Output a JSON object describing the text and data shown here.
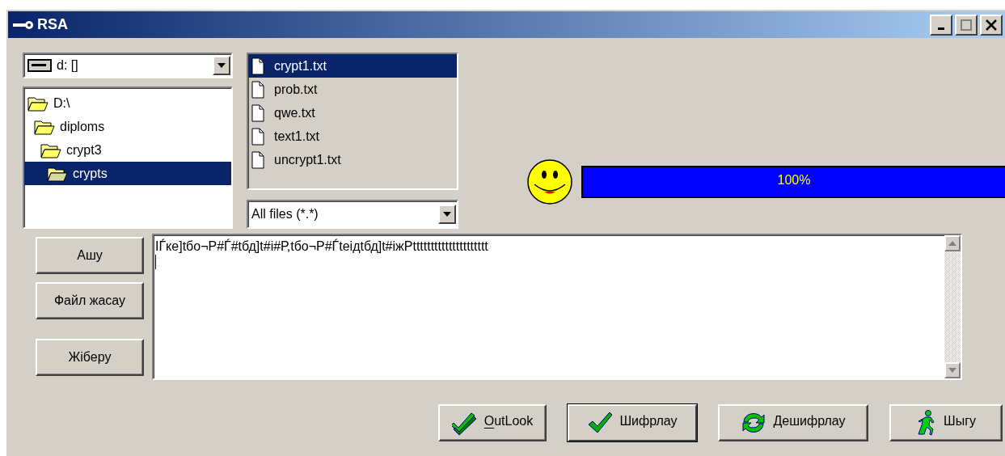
{
  "window": {
    "title": "RSA"
  },
  "drive_selector": {
    "value": "d: []"
  },
  "folder_tree": [
    {
      "label": "D:\\",
      "selected": false,
      "children": [
        {
          "label": "diploms",
          "selected": false,
          "children": [
            {
              "label": "crypt3",
              "selected": false,
              "children": [
                {
                  "label": "crypts",
                  "selected": true
                }
              ]
            }
          ]
        }
      ]
    }
  ],
  "file_list": [
    {
      "name": "crypt1.txt",
      "selected": true
    },
    {
      "name": "prob.txt",
      "selected": false
    },
    {
      "name": "qwe.txt",
      "selected": false
    },
    {
      "name": "text1.txt",
      "selected": false
    },
    {
      "name": "uncrypt1.txt",
      "selected": false
    }
  ],
  "file_filter": {
    "value": "All files (*.*)"
  },
  "progress": {
    "level": 1,
    "label": "100%"
  },
  "side_buttons": [
    "Ашу",
    "Файл жасау",
    "Жіберу"
  ],
  "editor": {
    "value": "IЃке]tбо¬Р#Ѓ#tбд]t#i#Р,tбо¬Р#Ѓteiдtбд]t#iжРttttttttttttttttttttt"
  },
  "action_buttons": [
    {
      "label": "OutLook",
      "kind": "double-check",
      "default": false,
      "shortcut": true
    },
    {
      "label": "Шифрлау",
      "kind": "check",
      "default": true,
      "shortcut": false
    },
    {
      "label": "Дешифрлау",
      "kind": "refresh",
      "default": false,
      "shortcut": false
    },
    {
      "label": "Шыгу",
      "kind": "runner",
      "default": false,
      "shortcut": false
    }
  ]
}
